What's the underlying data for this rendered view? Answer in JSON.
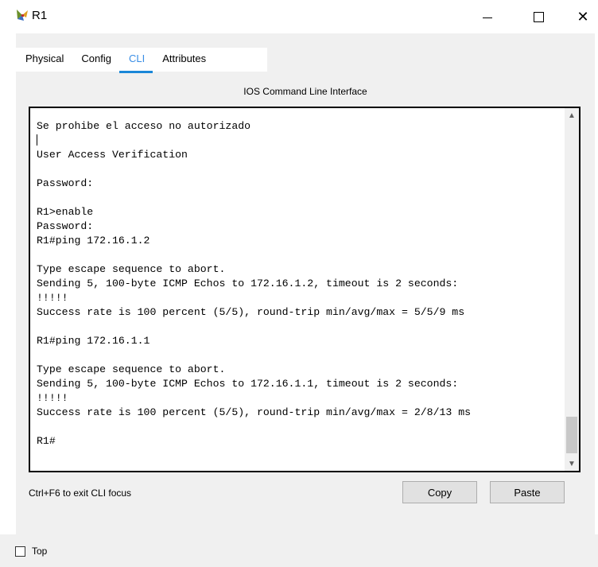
{
  "window": {
    "title": "R1",
    "icon": "router-icon"
  },
  "tabs": [
    {
      "label": "Physical",
      "active": false
    },
    {
      "label": "Config",
      "active": false
    },
    {
      "label": "CLI",
      "active": true
    },
    {
      "label": "Attributes",
      "active": false
    }
  ],
  "cli": {
    "section_title": "IOS Command Line Interface",
    "console_text": "Se prohibe el acceso no autorizado\n\nUser Access Verification\n\nPassword:\n\nR1>enable\nPassword:\nR1#ping 172.16.1.2\n\nType escape sequence to abort.\nSending 5, 100-byte ICMP Echos to 172.16.1.2, timeout is 2 seconds:\n!!!!!\nSuccess rate is 100 percent (5/5), round-trip min/avg/max = 5/5/9 ms\n\nR1#ping 172.16.1.1\n\nType escape sequence to abort.\nSending 5, 100-byte ICMP Echos to 172.16.1.1, timeout is 2 seconds:\n!!!!!\nSuccess rate is 100 percent (5/5), round-trip min/avg/max = 2/8/13 ms\n\nR1#",
    "focus_hint": "Ctrl+F6 to exit CLI focus",
    "copy_label": "Copy",
    "paste_label": "Paste"
  },
  "bottom": {
    "top_label": "Top",
    "top_checked": false
  }
}
